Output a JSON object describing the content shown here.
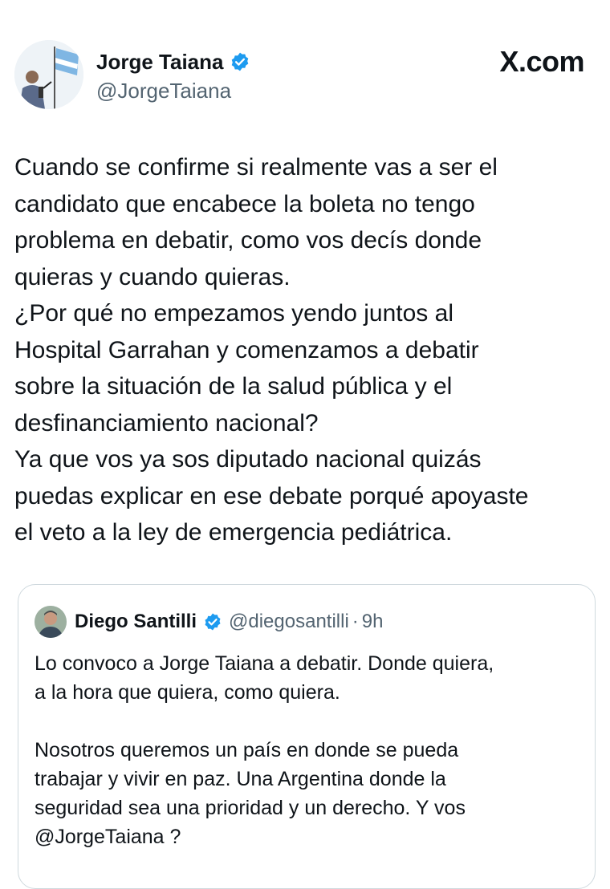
{
  "author": {
    "name": "Jorge Taiana",
    "handle": "@JorgeTaiana",
    "verified_color": "#1d9bf0",
    "avatar_icon": "profile-photo-speaker-with-flag"
  },
  "brand": {
    "label": "X.com"
  },
  "tweet": {
    "text": "Cuando se confirme si realmente vas a ser el\ncandidato que encabece la boleta no tengo\nproblema en debatir, como vos decís donde\nquieras y cuando quieras.\n¿Por qué no empezamos yendo juntos al\nHospital Garrahan y comenzamos a debatir\nsobre la situación de la salud pública y el\ndesfinanciamiento nacional?\nYa que vos ya sos diputado nacional quizás\npuedas explicar en ese debate porqué apoyaste\nel veto a la ley de emergencia pediátrica."
  },
  "quoted": {
    "name": "Diego Santilli",
    "handle": "@diegosantilli",
    "separator": "·",
    "time": "9h",
    "avatar_icon": "profile-photo-man",
    "text": "Lo convoco a Jorge Taiana a debatir. Donde quiera,\na la hora que quiera, como quiera.\n\nNosotros queremos un país en donde se pueda\ntrabajar y vivir en paz. Una Argentina donde la\nseguridad sea una prioridad y un derecho. Y vos\n@JorgeTaiana ?"
  }
}
